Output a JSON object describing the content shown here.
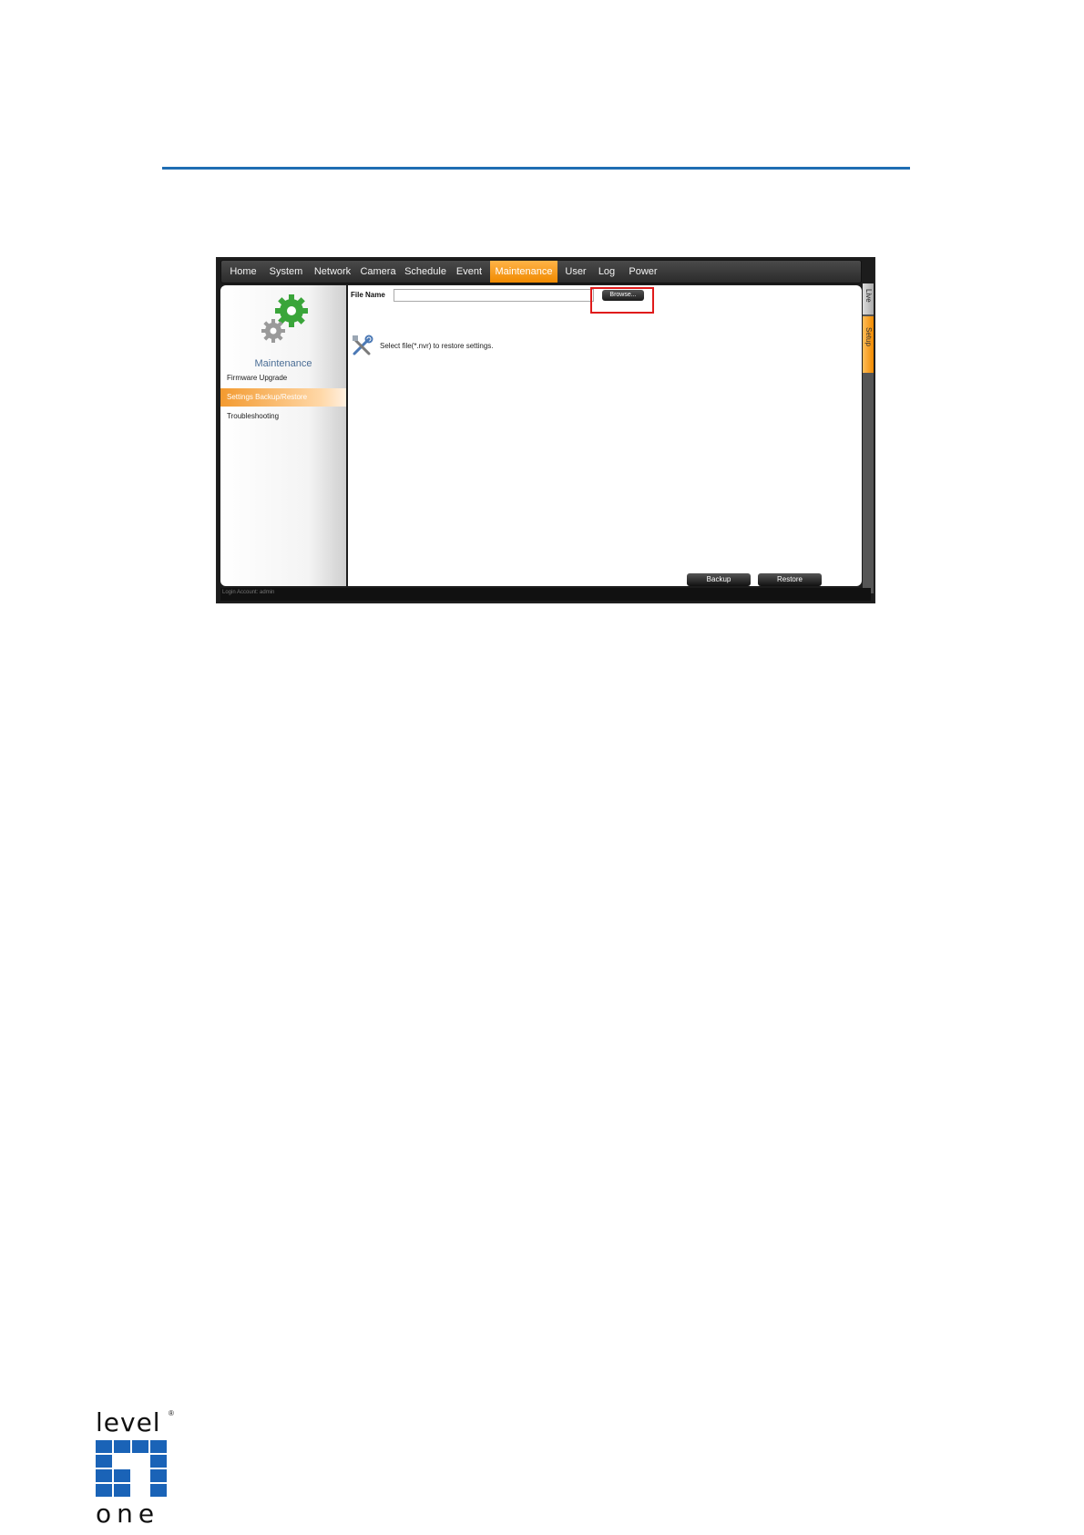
{
  "nav": {
    "items": [
      "Home",
      "System",
      "Network",
      "Camera",
      "Schedule",
      "Event",
      "Maintenance",
      "User",
      "Log",
      "Power"
    ],
    "active": "Maintenance"
  },
  "side_tabs": {
    "live": "Live",
    "setup": "Setup",
    "active": "Setup"
  },
  "sidebar": {
    "title": "Maintenance",
    "items": [
      "Firmware Upgrade",
      "Settings Backup/Restore",
      "Troubleshooting"
    ],
    "active": "Settings Backup/Restore"
  },
  "form": {
    "file_label": "File Name",
    "file_value": "",
    "browse_label": "Browse...",
    "hint": "Select file(*.nvr) to restore settings."
  },
  "buttons": {
    "backup": "Backup",
    "restore": "Restore"
  },
  "status": {
    "login": "Login Account: admin"
  },
  "logo": {
    "top": "level",
    "bottom": "one",
    "registered": "®"
  },
  "colors": {
    "accent": "#f08a00",
    "rule": "#1f6db3",
    "highlight": "#e01b1b"
  }
}
